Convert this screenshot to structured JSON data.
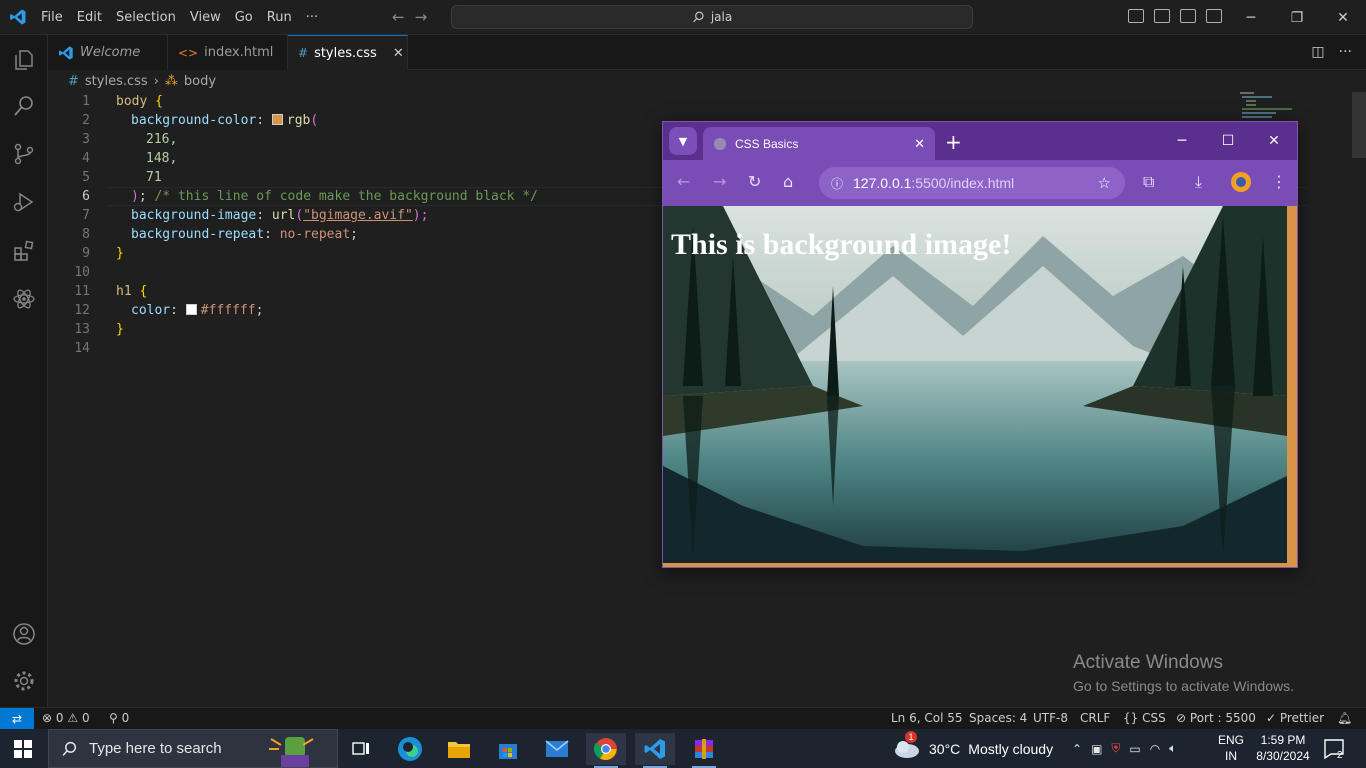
{
  "titlebar": {
    "menus": [
      "File",
      "Edit",
      "Selection",
      "View",
      "Go",
      "Run",
      "···"
    ],
    "search_text": "jala"
  },
  "tabs": [
    {
      "label": "Welcome",
      "icon": "vscode-logo-icon",
      "active": false
    },
    {
      "label": "index.html",
      "icon": "html-code-icon",
      "active": false
    },
    {
      "label": "styles.css",
      "icon": "css-hash-icon",
      "active": true
    }
  ],
  "breadcrumb": {
    "file": "styles.css",
    "symbol": "body"
  },
  "editor": {
    "line_numbers": [
      "1",
      "2",
      "3",
      "4",
      "5",
      "6",
      "7",
      "8",
      "9",
      "10",
      "11",
      "12",
      "13",
      "14"
    ],
    "current_line": 6,
    "code": {
      "l1_sel": "body",
      "l1_brace": "{",
      "l2_prop": "background-color",
      "l2_colon": ":",
      "l2_fn": "rgb",
      "l2_paren": "(",
      "l3": "216,",
      "l4": "148,",
      "l5": "71",
      "l6_paren": ")",
      "l6_semi": ";",
      "l6_comment": "/* this line of code make the background black */",
      "l7_prop": "background-image",
      "l7_colon": ":",
      "l7_fn": "url",
      "l7_open": "(",
      "l7_str": "\"bgimage.avif\"",
      "l7_close": ");",
      "l8_prop": "background-repeat",
      "l8_colon": ":",
      "l8_val": "no-repeat",
      "l8_semi": ";",
      "l9": "}",
      "l11_sel": "h1",
      "l11_brace": "{",
      "l12_prop": "color",
      "l12_colon": ":",
      "l12_val": "#ffffff",
      "l12_semi": ";",
      "l13": "}"
    },
    "swatches": {
      "rgb": "#d89447",
      "white": "#ffffff"
    }
  },
  "watermark": {
    "title": "Activate Windows",
    "subtitle": "Go to Settings to activate Windows."
  },
  "statusbar": {
    "errors": "0",
    "warnings": "0",
    "ports": "0",
    "position": "Ln 6, Col 55",
    "spaces": "Spaces: 4",
    "encoding": "UTF-8",
    "eol": "CRLF",
    "language": "CSS",
    "port": "Port : 5500",
    "prettier": "Prettier"
  },
  "browser": {
    "tab_title": "CSS Basics",
    "url_host": "127.0.0.1",
    "url_rest": ":5500/index.html",
    "heading": "This is background image!",
    "page_bg": "rgb(216, 148, 71)"
  },
  "taskbar": {
    "search_placeholder": "Type here to search",
    "weather": {
      "temp": "30°C",
      "condition": "Mostly cloudy",
      "badge": "1"
    },
    "language": {
      "line1": "ENG",
      "line2": "IN"
    },
    "clock": {
      "time": "1:59 PM",
      "date": "8/30/2024"
    },
    "notifications": "2"
  },
  "colors": {
    "accent": "#0078d4",
    "browser_theme": "#6b3fa0",
    "editor_bg": "#1f1f1f"
  }
}
